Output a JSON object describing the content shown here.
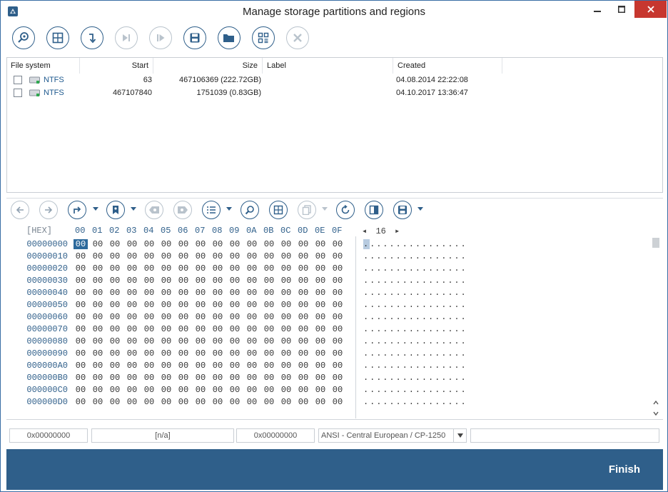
{
  "window": {
    "title": "Manage storage partitions and regions"
  },
  "partitions": {
    "columns": [
      "File system",
      "Start",
      "Size",
      "Label",
      "Created"
    ],
    "rows": [
      {
        "fs": "NTFS",
        "start": "63",
        "size": "467106369 (222.72GB)",
        "label": "",
        "created": "04.08.2014 22:22:08"
      },
      {
        "fs": "NTFS",
        "start": "467107840",
        "size": "1751039 (0.83GB)",
        "label": "",
        "created": "04.10.2017 13:36:47"
      }
    ]
  },
  "hex": {
    "header_label": "[HEX]",
    "columns": [
      "00",
      "01",
      "02",
      "03",
      "04",
      "05",
      "06",
      "07",
      "08",
      "09",
      "0A",
      "0B",
      "0C",
      "0D",
      "0E",
      "0F"
    ],
    "bytes_per_row_prefix": "◂",
    "bytes_per_row": "16",
    "bytes_per_row_suffix": "▸",
    "offsets": [
      "00000000",
      "00000010",
      "00000020",
      "00000030",
      "00000040",
      "00000050",
      "00000060",
      "00000070",
      "00000080",
      "00000090",
      "000000A0",
      "000000B0",
      "000000C0",
      "000000D0"
    ],
    "byte_value": "00",
    "ascii_row": "................"
  },
  "status": {
    "offset": "0x00000000",
    "selection": "[n/a]",
    "value": "0x00000000",
    "encoding": "ANSI - Central European / CP-1250",
    "extra": ""
  },
  "footer": {
    "finish_label": "Finish"
  },
  "icons": {
    "toolbar1": [
      "scan-icon",
      "partition-grid-icon",
      "load-down-icon",
      "skip-end-icon",
      "play-step-icon",
      "save-icon",
      "open-folder-icon",
      "region-layout-icon",
      "cancel-icon"
    ],
    "toolbar2": [
      "back-icon",
      "forward-icon",
      "goto-icon",
      "bookmark-icon",
      "prev-bookmark-icon",
      "next-bookmark-icon",
      "list-icon",
      "find-icon",
      "grid-icon",
      "copy-icon",
      "refresh-icon",
      "panel-icon",
      "save-icon"
    ]
  },
  "colors": {
    "accent": "#2f5f8a",
    "close": "#c7372f",
    "selected_byte": "#2d6a9c"
  }
}
